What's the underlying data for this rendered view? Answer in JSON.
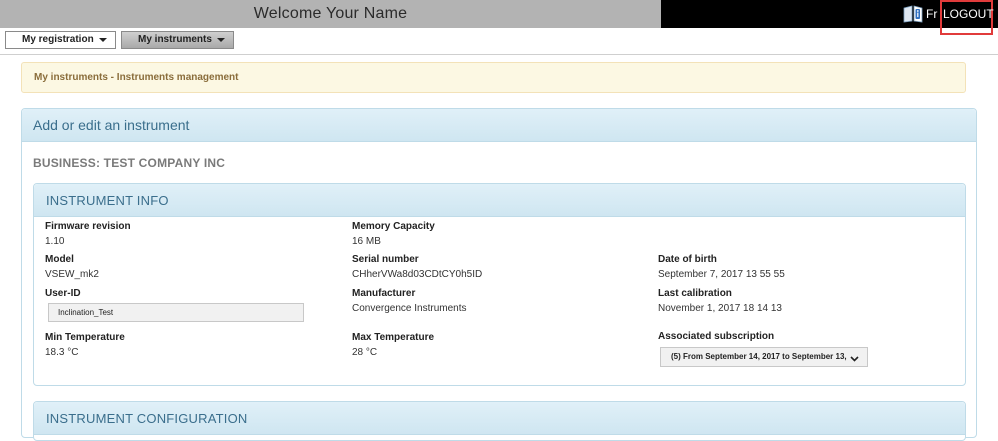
{
  "header": {
    "welcome": "Welcome  Your Name",
    "lang": "Fr",
    "logout": "LOGOUT",
    "help_icon": "book-help-icon"
  },
  "menu": {
    "items": [
      {
        "label": "My registration"
      },
      {
        "label": "My instruments"
      }
    ]
  },
  "notice": {
    "text": "My instruments - Instruments management"
  },
  "panel": {
    "title": "Add or edit an instrument",
    "business": "BUSINESS: TEST COMPANY INC"
  },
  "instrument_info": {
    "title": "INSTRUMENT INFO",
    "firmware_label": "Firmware revision",
    "firmware_value": "1.10",
    "memory_label": "Memory Capacity",
    "memory_value": "16 MB",
    "model_label": "Model",
    "model_value": "VSEW_mk2",
    "serial_label": "Serial number",
    "serial_value": "CHherVWa8d03CDtCY0h5ID",
    "dob_label": "Date of birth",
    "dob_value": "September 7, 2017 13 55 55",
    "userid_label": "User-ID",
    "userid_value": "Inclination_Test",
    "manufacturer_label": "Manufacturer",
    "manufacturer_value": "Convergence Instruments",
    "calibration_label": "Last calibration",
    "calibration_value": "November 1, 2017 18 14 13",
    "min_temp_label": "Min Temperature",
    "min_temp_value": "18.3 °C",
    "max_temp_label": "Max Temperature",
    "max_temp_value": "28 °C",
    "subscription_label": "Associated subscription",
    "subscription_value": "(5) From September 14, 2017 to September 13,"
  },
  "instrument_config": {
    "title": "INSTRUMENT CONFIGURATION"
  },
  "colors": {
    "topbar_left": "#b3b3b3",
    "topbar_right": "#000000",
    "logout_highlight": "#e13b3b",
    "panel_header": "#d8ecf5",
    "notice_bg": "#fcf8e3"
  }
}
